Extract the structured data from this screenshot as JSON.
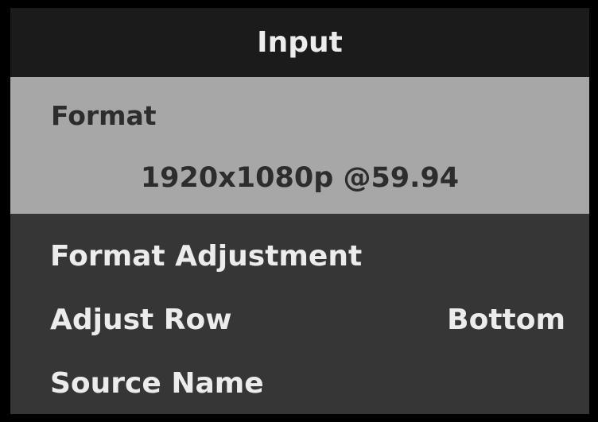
{
  "menu": {
    "title": "Input",
    "selected_item": {
      "label": "Format",
      "value": "1920x1080p @59.94"
    },
    "items": [
      {
        "label": "Format Adjustment",
        "value": ""
      },
      {
        "label": "Adjust Row",
        "value": "Bottom"
      },
      {
        "label": "Source Name",
        "value": ""
      }
    ]
  },
  "colors": {
    "background": "#000000",
    "panel": "#363636",
    "header": "#1b1b1b",
    "highlight": "#a7a7a7",
    "text_light": "#ececec",
    "text_dark": "#2d2d2d"
  }
}
